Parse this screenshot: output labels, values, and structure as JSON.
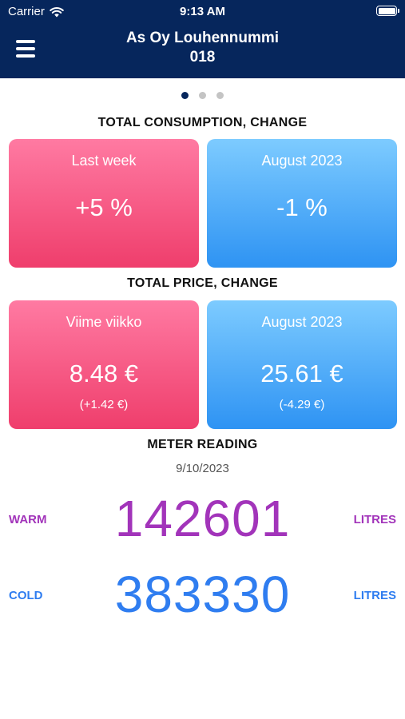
{
  "status_bar": {
    "carrier": "Carrier",
    "time": "9:13 AM"
  },
  "header": {
    "title_line1": "As Oy Louhennummi",
    "title_line2": "018"
  },
  "pager": {
    "count": 3,
    "active_index": 0
  },
  "consumption": {
    "title": "TOTAL CONSUMPTION, CHANGE",
    "week": {
      "label": "Last week",
      "value": "+5 %"
    },
    "month": {
      "label": "August 2023",
      "value": "-1 %"
    }
  },
  "price": {
    "title": "TOTAL PRICE, CHANGE",
    "week": {
      "label": "Viime viikko",
      "value": "8.48 €",
      "change": "(+1.42 €)"
    },
    "month": {
      "label": "August 2023",
      "value": "25.61 €",
      "change": "(-4.29 €)"
    }
  },
  "meter": {
    "title": "METER READING",
    "date": "9/10/2023",
    "warm": {
      "label": "WARM",
      "value": "142601",
      "unit": "LITRES"
    },
    "cold": {
      "label": "COLD",
      "value": "383330",
      "unit": "LITRES"
    }
  },
  "colors": {
    "nav_bg": "#06265c",
    "pink_card": "#ef3e6c",
    "blue_card": "#2e93f3",
    "warm": "#a234ba",
    "cold": "#2f7df0"
  }
}
